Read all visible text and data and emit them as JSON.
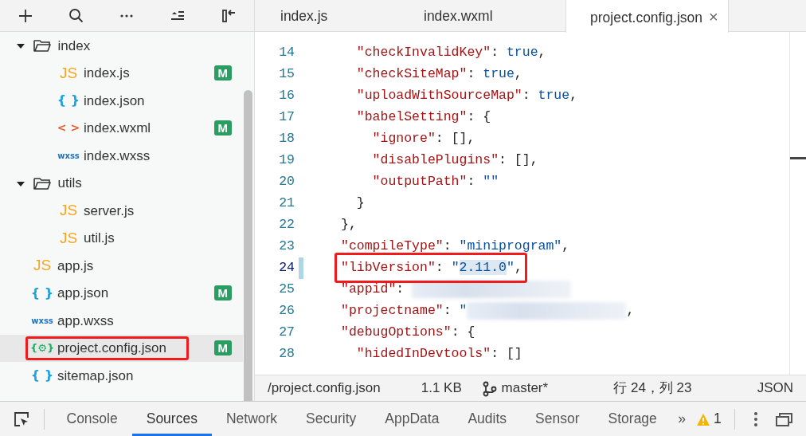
{
  "sidebar": {
    "toolbar": [
      {
        "kind": "add"
      },
      {
        "kind": "search"
      },
      {
        "kind": "more"
      },
      {
        "kind": "collapse"
      },
      {
        "kind": "panel"
      }
    ],
    "tree": [
      {
        "kind": "folder",
        "label": "index",
        "expanded": true,
        "children": [
          {
            "kind": "js",
            "icon": "JS",
            "label": "index.js",
            "badge": "M",
            "selected": false,
            "annotated": false
          },
          {
            "kind": "json",
            "icon": "{ }",
            "label": "index.json",
            "selected": false,
            "annotated": false
          },
          {
            "kind": "wxml",
            "icon": "< >",
            "label": "index.wxml",
            "badge": "M",
            "selected": false,
            "annotated": false
          },
          {
            "kind": "wxss",
            "icon": "wxss",
            "label": "index.wxss",
            "selected": false,
            "annotated": false
          }
        ]
      },
      {
        "kind": "folder",
        "label": "utils",
        "expanded": true,
        "children": [
          {
            "kind": "js",
            "icon": "JS",
            "label": "server.js",
            "selected": false,
            "annotated": false
          },
          {
            "kind": "js",
            "icon": "JS",
            "label": "util.js",
            "selected": false,
            "annotated": false
          }
        ]
      },
      {
        "kind": "js",
        "icon": "JS",
        "label": "app.js",
        "selected": false,
        "annotated": false
      },
      {
        "kind": "json",
        "icon": "{ }",
        "label": "app.json",
        "badge": "M",
        "selected": false,
        "annotated": false
      },
      {
        "kind": "wxss",
        "icon": "wxss",
        "label": "app.wxss",
        "selected": false,
        "annotated": false
      },
      {
        "kind": "config",
        "icon": "{⚙}",
        "label": "project.config.json",
        "badge": "M",
        "selected": true,
        "annotated": true
      },
      {
        "kind": "json",
        "icon": "{ }",
        "label": "sitemap.json",
        "selected": false,
        "annotated": false
      }
    ]
  },
  "tabs": [
    {
      "label": "index.js",
      "selected": false
    },
    {
      "label": "index.wxml",
      "selected": false
    },
    {
      "label": "project.config.json",
      "selected": true,
      "close": "×"
    }
  ],
  "editor": {
    "lines": [
      {
        "number": "14",
        "current": false,
        "annotated": false,
        "tokens": [
          {
            "kind": "key",
            "text": "  \"checkInvalidKey\""
          },
          {
            "kind": "punct",
            "text": ": "
          },
          {
            "kind": "value",
            "text": "true"
          },
          {
            "kind": "punct",
            "text": ","
          }
        ]
      },
      {
        "number": "15",
        "current": false,
        "annotated": false,
        "tokens": [
          {
            "kind": "key",
            "text": "  \"checkSiteMap\""
          },
          {
            "kind": "punct",
            "text": ": "
          },
          {
            "kind": "value",
            "text": "true"
          },
          {
            "kind": "punct",
            "text": ","
          }
        ]
      },
      {
        "number": "16",
        "current": false,
        "annotated": false,
        "tokens": [
          {
            "kind": "key",
            "text": "  \"uploadWithSourceMap\""
          },
          {
            "kind": "punct",
            "text": ": "
          },
          {
            "kind": "value",
            "text": "true"
          },
          {
            "kind": "punct",
            "text": ","
          }
        ]
      },
      {
        "number": "17",
        "current": false,
        "annotated": false,
        "tokens": [
          {
            "kind": "key",
            "text": "  \"babelSetting\""
          },
          {
            "kind": "punct",
            "text": ": {"
          }
        ]
      },
      {
        "number": "18",
        "current": false,
        "annotated": false,
        "tokens": [
          {
            "kind": "key",
            "text": "    \"ignore\""
          },
          {
            "kind": "punct",
            "text": ": [],"
          }
        ]
      },
      {
        "number": "19",
        "current": false,
        "annotated": false,
        "tokens": [
          {
            "kind": "key",
            "text": "    \"disablePlugins\""
          },
          {
            "kind": "punct",
            "text": ": [],"
          }
        ]
      },
      {
        "number": "20",
        "current": false,
        "annotated": false,
        "tokens": [
          {
            "kind": "key",
            "text": "    \"outputPath\""
          },
          {
            "kind": "punct",
            "text": ": "
          },
          {
            "kind": "value",
            "text": "\"\""
          }
        ]
      },
      {
        "number": "21",
        "current": false,
        "annotated": false,
        "tokens": [
          {
            "kind": "punct",
            "text": "  }"
          }
        ]
      },
      {
        "number": "22",
        "current": false,
        "annotated": false,
        "tokens": [
          {
            "kind": "punct",
            "text": "},"
          }
        ]
      },
      {
        "number": "23",
        "current": false,
        "annotated": false,
        "tokens": [
          {
            "kind": "key",
            "text": "\"compileType\""
          },
          {
            "kind": "punct",
            "text": ": "
          },
          {
            "kind": "value",
            "text": "\"miniprogram\""
          },
          {
            "kind": "punct",
            "text": ","
          }
        ]
      },
      {
        "number": "24",
        "current": true,
        "annotated": true,
        "tokens": [
          {
            "kind": "key",
            "text": "\"libVersion\""
          },
          {
            "kind": "punct",
            "text": ": "
          },
          {
            "kind": "value",
            "text": "\""
          },
          {
            "kind": "selected-value",
            "text": "2.11.0"
          },
          {
            "kind": "value",
            "text": "\""
          },
          {
            "kind": "punct",
            "text": ","
          }
        ]
      },
      {
        "number": "25",
        "current": false,
        "annotated": false,
        "tokens": [
          {
            "kind": "key",
            "text": "\"appid\""
          },
          {
            "kind": "punct",
            "text": ": "
          },
          {
            "kind": "redacted"
          }
        ]
      },
      {
        "number": "26",
        "current": false,
        "annotated": false,
        "tokens": [
          {
            "kind": "key",
            "text": "\"projectname\""
          },
          {
            "kind": "punct",
            "text": ": "
          },
          {
            "kind": "value",
            "text": "\""
          },
          {
            "kind": "redacted"
          },
          {
            "kind": "punct",
            "text": ","
          }
        ]
      },
      {
        "number": "27",
        "current": false,
        "annotated": false,
        "tokens": [
          {
            "kind": "key",
            "text": "\"debugOptions\""
          },
          {
            "kind": "punct",
            "text": ": {"
          }
        ]
      },
      {
        "number": "28",
        "current": false,
        "annotated": false,
        "tokens": [
          {
            "kind": "key",
            "text": "  \"hidedInDevtools\""
          },
          {
            "kind": "punct",
            "text": ": []"
          }
        ]
      }
    ]
  },
  "status_bar": {
    "path": "/project.config.json",
    "size": "1.1 KB",
    "branch": "master*",
    "position": "行 24，列 23",
    "language": "JSON"
  },
  "devtools": {
    "tabs": [
      {
        "label": "Console",
        "selected": false
      },
      {
        "label": "Sources",
        "selected": true
      },
      {
        "label": "Network",
        "selected": false
      },
      {
        "label": "Security",
        "selected": false
      },
      {
        "label": "AppData",
        "selected": false
      },
      {
        "label": "Audits",
        "selected": false
      },
      {
        "label": "Sensor",
        "selected": false
      },
      {
        "label": "Storage",
        "selected": false
      }
    ],
    "overflow": "»",
    "warnings": "1"
  }
}
